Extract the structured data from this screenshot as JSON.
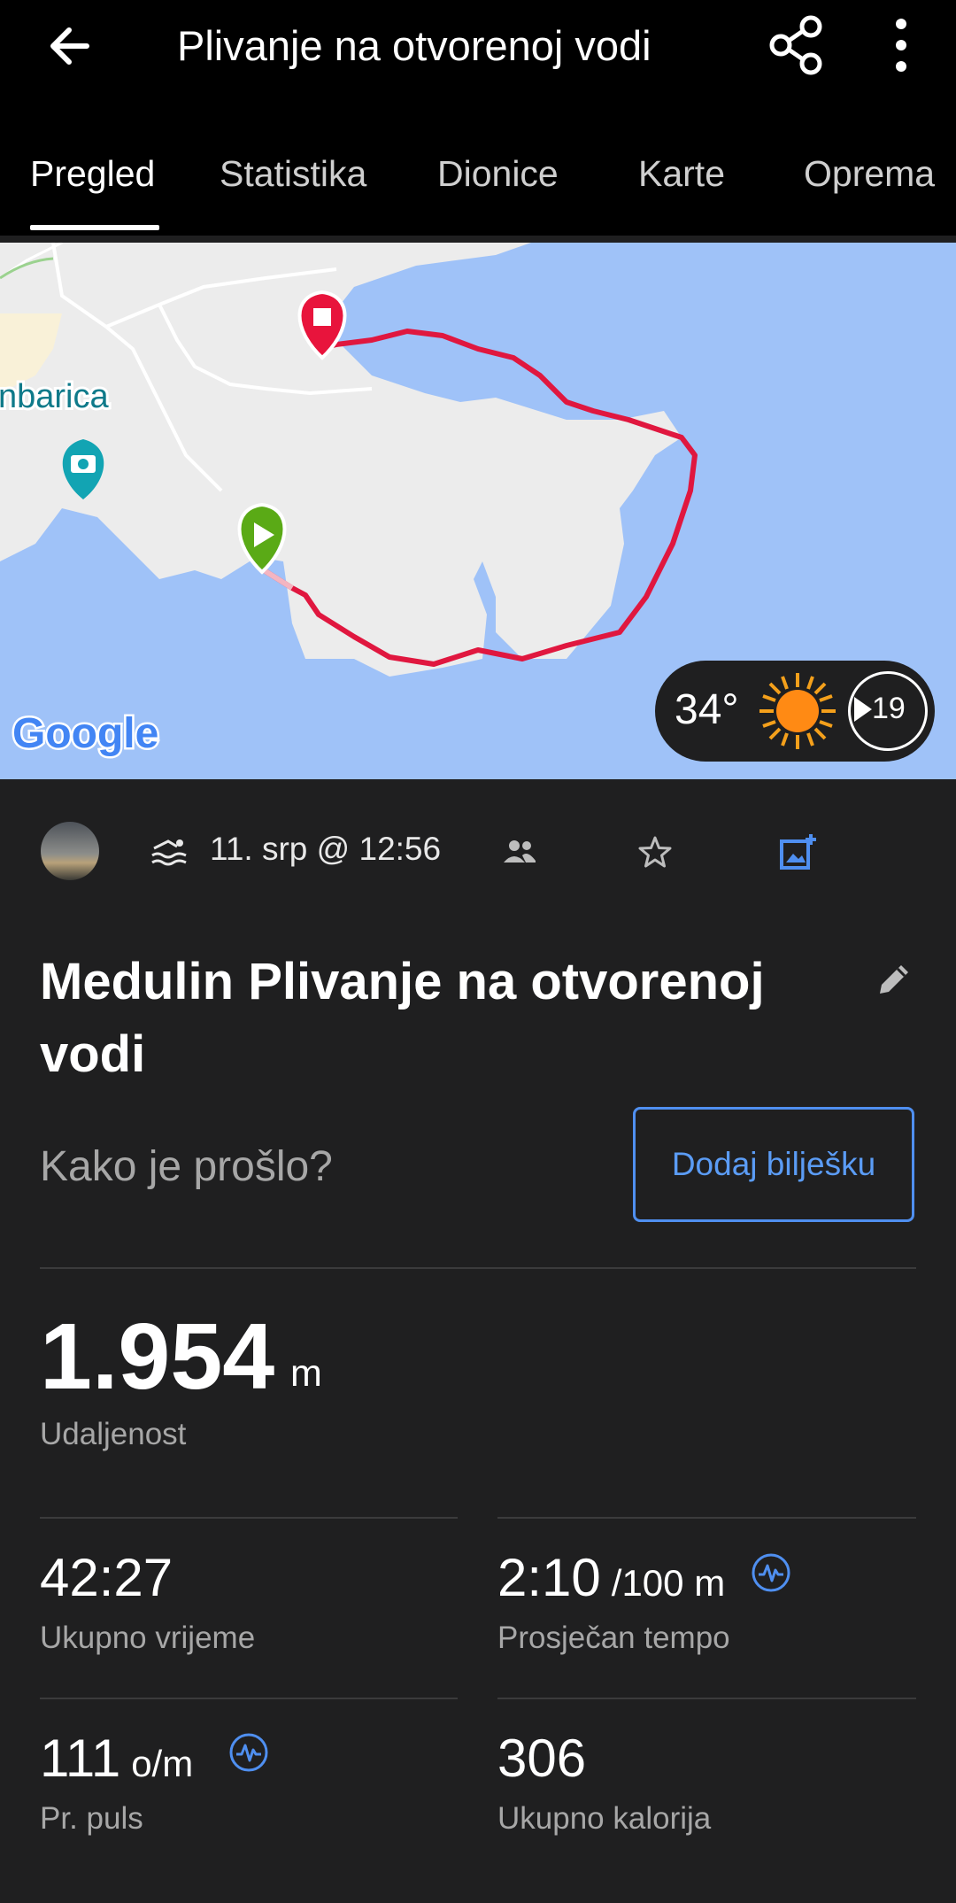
{
  "header": {
    "title": "Plivanje na otvorenoj vodi",
    "back_icon": "arrow-left-icon",
    "share_icon": "share-icon",
    "more_icon": "more-vert-icon"
  },
  "tabs": [
    {
      "label": "Pregled",
      "active": true
    },
    {
      "label": "Statistika",
      "active": false
    },
    {
      "label": "Dionice",
      "active": false
    },
    {
      "label": "Karte",
      "active": false
    },
    {
      "label": "Oprema",
      "active": false
    }
  ],
  "map": {
    "place_label": "nbarica",
    "attribution": "Google",
    "weather": {
      "temperature": "34°",
      "wind": "19",
      "icon": "sun-icon"
    },
    "colors": {
      "water": "#9fc2f8",
      "land": "#ececec",
      "route": "#e0173f",
      "start": "#5aaa16",
      "end": "#e8143c"
    }
  },
  "activity": {
    "date": "11. srp @ 12:56",
    "title": "Medulin Plivanje na otvorenoj vodi",
    "prompt": "Kako je prošlo?",
    "add_note": "Dodaj bilješku"
  },
  "stats": {
    "distance": {
      "value": "1.954",
      "unit": "m",
      "label": "Udaljenost"
    },
    "total_time": {
      "value": "42:27",
      "label": "Ukupno vrijeme"
    },
    "avg_pace": {
      "value": "2:10",
      "unit": "/100 m",
      "label": "Prosječan tempo"
    },
    "avg_hr": {
      "value": "111",
      "unit": "o/m",
      "label": "Pr. puls"
    },
    "calories": {
      "value": "306",
      "label": "Ukupno kalorija"
    }
  },
  "accent_color": "#4f8ff0"
}
